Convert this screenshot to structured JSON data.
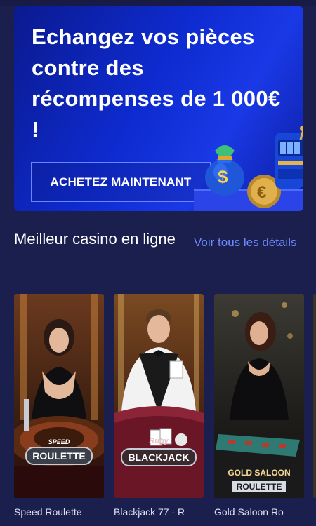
{
  "promo": {
    "title": "Echangez vos pièces contre des récompenses de 1 000€ !",
    "button_label": "ACHETEZ MAINTENANT"
  },
  "section": {
    "title": "Meilleur casino en ligne",
    "see_all": "Voir tous les détails"
  },
  "games": [
    {
      "caption": "Speed Roulette",
      "logo_small": "SPEED",
      "logo_main": "ROULETTE"
    },
    {
      "caption": "Blackjack 77 - R",
      "logo_small": "Ruby",
      "logo_main": "BLACKJACK"
    },
    {
      "caption": "Gold Saloon Ro",
      "logo_small": "GOLD SALOON",
      "logo_main": "ROULETTE"
    }
  ],
  "colors": {
    "background": "#1b1f4e",
    "banner": "#0e2bd0",
    "link": "#6d8cff"
  }
}
